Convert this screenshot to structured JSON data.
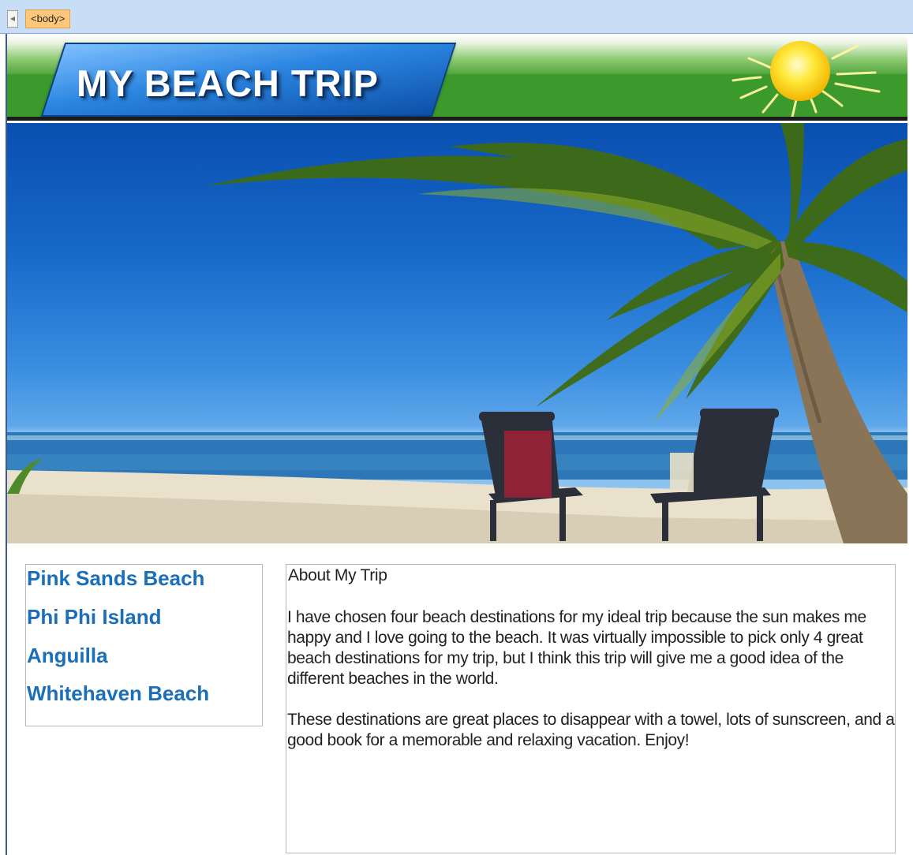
{
  "editor": {
    "tag_label": "<body>"
  },
  "header": {
    "logo_text": "MY BEACH TRIP"
  },
  "hero": {
    "image_icon": "beach-photo"
  },
  "nav": {
    "items": [
      {
        "label": "Pink Sands Beach"
      },
      {
        "label": "Phi Phi Island"
      },
      {
        "label": "Anguilla"
      },
      {
        "label": "Whitehaven Beach"
      }
    ]
  },
  "content": {
    "title": "About My Trip",
    "paragraphs": [
      "I have chosen four beach destinations for my ideal trip because the sun makes me happy and I love going to the beach. It was virtually impossible to pick only 4 great beach destinations for my trip, but I think this trip will give me a good idea of the different beaches in the world.",
      "These destinations are great places to disappear with a towel, lots of sunscreen, and a good book for a memorable and relaxing vacation. Enjoy!"
    ]
  },
  "colors": {
    "nav_link": "#1a6fb8",
    "banner_green": "#3c9a2c",
    "logo_blue": "#2b86e0",
    "tag_highlight": "#ffc77a"
  }
}
